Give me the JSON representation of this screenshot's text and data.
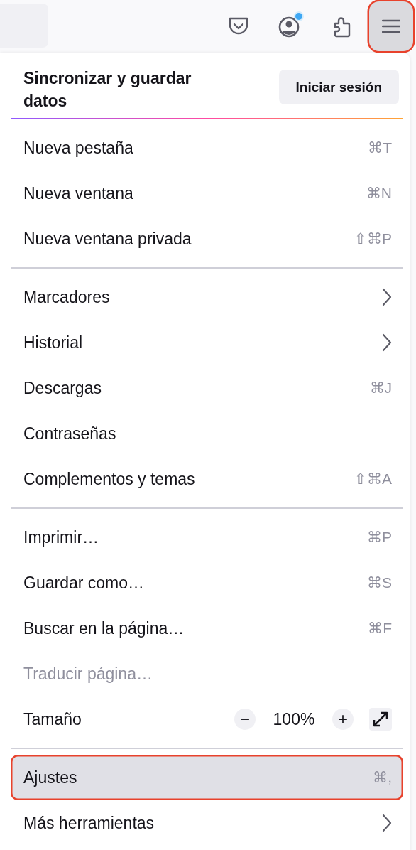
{
  "toolbar": {
    "account_badge": true,
    "menu_button": {
      "highlighted": true
    }
  },
  "header": {
    "title": "Sincronizar y guardar datos",
    "button": "Iniciar sesión"
  },
  "groups": [
    {
      "items": [
        {
          "kind": "item",
          "label": "Nueva pestaña",
          "shortcut": "⌘T",
          "submenu": false,
          "disabled": false,
          "highlighted": false
        },
        {
          "kind": "item",
          "label": "Nueva ventana",
          "shortcut": "⌘N",
          "submenu": false,
          "disabled": false,
          "highlighted": false
        },
        {
          "kind": "item",
          "label": "Nueva ventana privada",
          "shortcut": "⇧⌘P",
          "submenu": false,
          "disabled": false,
          "highlighted": false
        }
      ]
    },
    {
      "items": [
        {
          "kind": "item",
          "label": "Marcadores",
          "submenu": true,
          "disabled": false,
          "highlighted": false
        },
        {
          "kind": "item",
          "label": "Historial",
          "submenu": true,
          "disabled": false,
          "highlighted": false
        },
        {
          "kind": "item",
          "label": "Descargas",
          "shortcut": "⌘J",
          "submenu": false,
          "disabled": false,
          "highlighted": false
        },
        {
          "kind": "item",
          "label": "Contraseñas",
          "submenu": false,
          "disabled": false,
          "highlighted": false
        },
        {
          "kind": "item",
          "label": "Complementos y temas",
          "shortcut": "⇧⌘A",
          "submenu": false,
          "disabled": false,
          "highlighted": false
        }
      ]
    },
    {
      "items": [
        {
          "kind": "item",
          "label": "Imprimir…",
          "shortcut": "⌘P",
          "submenu": false,
          "disabled": false,
          "highlighted": false
        },
        {
          "kind": "item",
          "label": "Guardar como…",
          "shortcut": "⌘S",
          "submenu": false,
          "disabled": false,
          "highlighted": false
        },
        {
          "kind": "item",
          "label": "Buscar en la página…",
          "shortcut": "⌘F",
          "submenu": false,
          "disabled": false,
          "highlighted": false
        },
        {
          "kind": "item",
          "label": "Traducir página…",
          "submenu": false,
          "disabled": true,
          "highlighted": false
        },
        {
          "kind": "zoom",
          "label": "Tamaño",
          "decrease": "−",
          "value": "100%",
          "increase": "+"
        }
      ]
    },
    {
      "items": [
        {
          "kind": "item",
          "label": "Ajustes",
          "shortcut": "⌘,",
          "submenu": false,
          "disabled": false,
          "highlighted": true
        },
        {
          "kind": "item",
          "label": "Más herramientas",
          "submenu": true,
          "disabled": false,
          "highlighted": false
        }
      ]
    }
  ]
}
